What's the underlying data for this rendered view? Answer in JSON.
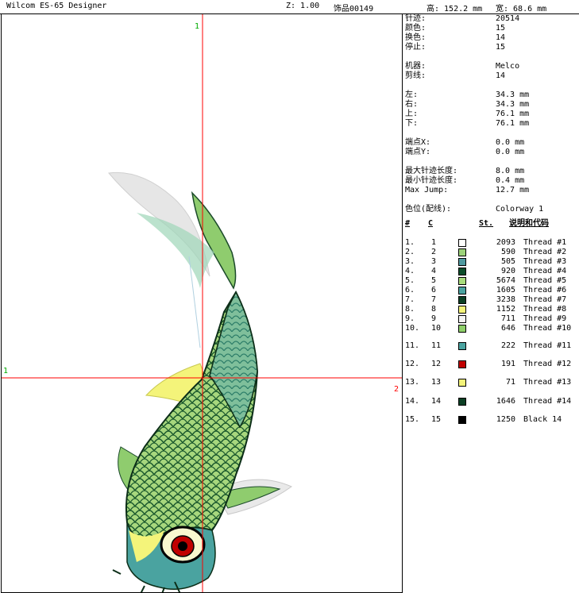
{
  "header": {
    "app_title": "Wilcom ES-65 Designer",
    "zoom": "Z: 1.00",
    "design_name": "饰品00149",
    "height": "高: 152.2 mm",
    "width": "宽: 68.6 mm"
  },
  "canvas": {
    "markers": {
      "top": "1",
      "left": "1",
      "right": "2"
    },
    "colors": {
      "crosshair": "#ff0000",
      "marker": "#00aa00"
    }
  },
  "info": {
    "rows": [
      {
        "label": "针迹:",
        "value": "20514"
      },
      {
        "label": "颜色:",
        "value": "15"
      },
      {
        "label": "换色:",
        "value": "14"
      },
      {
        "label": "停止:",
        "value": "15"
      },
      {
        "label": "机器:",
        "value": "Melco"
      },
      {
        "label": "剪线:",
        "value": "14"
      },
      {
        "label": "左:",
        "value": "34.3 mm"
      },
      {
        "label": "右:",
        "value": "34.3 mm"
      },
      {
        "label": "上:",
        "value": "76.1 mm"
      },
      {
        "label": "下:",
        "value": "76.1 mm"
      },
      {
        "label": "端点X:",
        "value": "0.0 mm"
      },
      {
        "label": "端点Y:",
        "value": "0.0 mm"
      },
      {
        "label": "最大针迹长度:",
        "value": "8.0 mm"
      },
      {
        "label": "最小针迹长度:",
        "value": "0.4 mm"
      },
      {
        "label": "Max Jump:",
        "value": "12.7 mm"
      },
      {
        "label": "色位(配线):",
        "value": "Colorway 1"
      }
    ],
    "table_headers": {
      "num": "#",
      "color": "C",
      "stitches": "St.",
      "desc": "说明和代码"
    },
    "threads": [
      {
        "idx": "1.",
        "c": "1",
        "st": "2093",
        "name": "Thread #1",
        "color": "#ffffff"
      },
      {
        "idx": "2.",
        "c": "2",
        "st": "590",
        "name": "Thread #2",
        "color": "#9cd27a"
      },
      {
        "idx": "3.",
        "c": "3",
        "st": "505",
        "name": "Thread #3",
        "color": "#4f9aa0"
      },
      {
        "idx": "4.",
        "c": "4",
        "st": "920",
        "name": "Thread #4",
        "color": "#0b4d2a"
      },
      {
        "idx": "5.",
        "c": "5",
        "st": "5674",
        "name": "Thread #5",
        "color": "#a8dc7c"
      },
      {
        "idx": "6.",
        "c": "6",
        "st": "1605",
        "name": "Thread #6",
        "color": "#4aa3a0"
      },
      {
        "idx": "7.",
        "c": "7",
        "st": "3238",
        "name": "Thread #7",
        "color": "#0b3f24"
      },
      {
        "idx": "8.",
        "c": "8",
        "st": "1152",
        "name": "Thread #8",
        "color": "#f4f47a"
      },
      {
        "idx": "9.",
        "c": "9",
        "st": "711",
        "name": "Thread #9",
        "color": "#f5f5f5"
      },
      {
        "idx": "10.",
        "c": "10",
        "st": "646",
        "name": "Thread #10",
        "color": "#8fcf6a"
      },
      {
        "idx": "11.",
        "c": "11",
        "st": "222",
        "name": "Thread #11",
        "color": "#4aa3a0"
      },
      {
        "idx": "12.",
        "c": "12",
        "st": "191",
        "name": "Thread #12",
        "color": "#c00000"
      },
      {
        "idx": "13.",
        "c": "13",
        "st": "71",
        "name": "Thread #13",
        "color": "#f4f47a"
      },
      {
        "idx": "14.",
        "c": "14",
        "st": "1646",
        "name": "Thread #14",
        "color": "#0b3f24"
      },
      {
        "idx": "15.",
        "c": "15",
        "st": "1250",
        "name": "Black 14",
        "color": "#000000"
      }
    ]
  }
}
